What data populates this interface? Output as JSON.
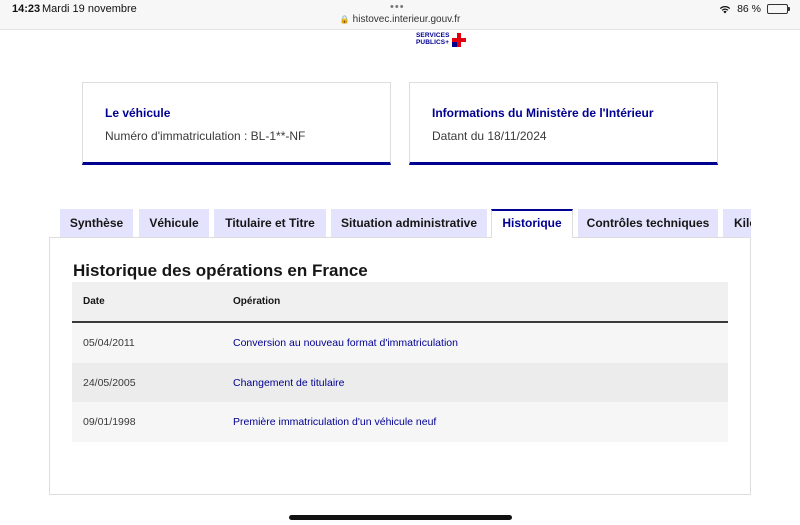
{
  "status_bar": {
    "time": "14:23",
    "date": "Mardi 19 novembre",
    "url": "histovec.interieur.gouv.fr",
    "battery": "86 %",
    "battery_level": 0.86
  },
  "logo": {
    "line1": "SERVICES",
    "line2": "PUBLICS+",
    "colors": {
      "blue": "#000091",
      "red": "#e1000f"
    }
  },
  "cards": {
    "vehicle": {
      "title": "Le véhicule",
      "value": "Numéro d'immatriculation : BL-1**-NF"
    },
    "ministry": {
      "title": "Informations du Ministère de l'Intérieur",
      "value": "Datant du 18/11/2024"
    }
  },
  "tabs": [
    {
      "label": "Synthèse",
      "active": false
    },
    {
      "label": "Véhicule",
      "active": false
    },
    {
      "label": "Titulaire et Titre",
      "active": false
    },
    {
      "label": "Situation administrative",
      "active": false
    },
    {
      "label": "Historique",
      "active": true
    },
    {
      "label": "Contrôles techniques",
      "active": false
    },
    {
      "label": "Kilo",
      "active": false
    }
  ],
  "history": {
    "title": "Historique des opérations en France",
    "columns": {
      "date": "Date",
      "operation": "Opération"
    },
    "rows": [
      {
        "date": "05/04/2011",
        "operation": "Conversion au nouveau format d'immatriculation"
      },
      {
        "date": "24/05/2005",
        "operation": "Changement de titulaire"
      },
      {
        "date": "09/01/1998",
        "operation": "Première immatriculation d'un véhicule neuf"
      }
    ]
  },
  "colors": {
    "accent": "#000091",
    "tab_background": "#e3e3fd",
    "text": "#161616"
  }
}
